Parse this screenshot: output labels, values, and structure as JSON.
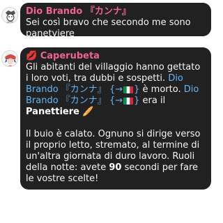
{
  "messages": [
    {
      "sender": "Dio Brando 『カンナ』",
      "text": "Sei così bravo che secondo me sono panetyiere"
    },
    {
      "sender_emoji": "💋",
      "sender": "Caperubeta",
      "para1_a": "Gli abitanti del villaggio hanno gettato i loro voti, tra dubbi e sospetti. ",
      "mention_name": "Dio Brando 『カンナ』",
      "mention_tag_open": "{",
      "mention_tag_arrow": "→",
      "mention_tag_close": "}",
      "para1_b": " è morto.",
      "para1_c": " era il ",
      "role": "Panettiere",
      "role_emoji": "🥖",
      "para2_a": "Il buio è calato. Ognuno si dirige verso il proprio letto, stremato, al termine di un'altra giornata di duro lavoro.  Ruoli della notte: avete ",
      "seconds": "90",
      "para2_b": " secondi per fare le vostre scelte!"
    }
  ]
}
